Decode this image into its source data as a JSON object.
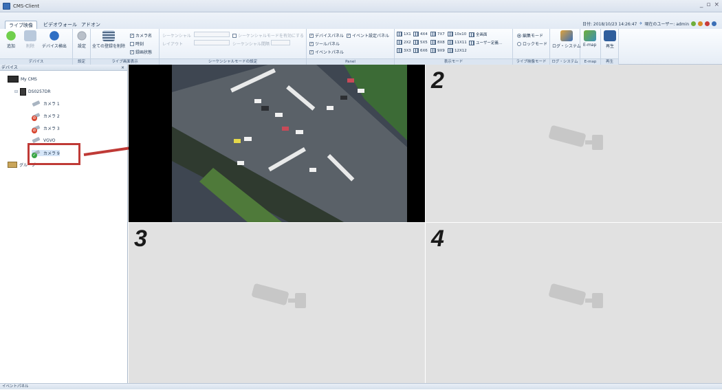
{
  "window": {
    "title": "CMS-Client",
    "controls": [
      "_",
      "▫",
      "×"
    ]
  },
  "tabs": [
    {
      "label": "ライブ映像",
      "active": true
    },
    {
      "label": "ビデオウォール",
      "active": false
    },
    {
      "label": "アドオン",
      "active": false
    }
  ],
  "status": {
    "date": "日付: 2018/10/23 14:26:47",
    "user": "現在のユーザー: admin"
  },
  "ribbon": {
    "device": {
      "group": "デバイス",
      "add": "追加",
      "delete": "削除",
      "detect": "デバイス検出"
    },
    "settings": {
      "group": "設定",
      "settings": "設定"
    },
    "live_display": {
      "group": "ライブ画面表示",
      "delete_all": "全ての登録を削除",
      "camera_name": "カメラ名",
      "time": "時刻",
      "record_state": "録画状態"
    },
    "sequence": {
      "group": "シーケンシャルモードの設定",
      "sequential": "シーケンシャル",
      "layout": "レイアウト",
      "enable": "シーケンシャルモードを有効にする",
      "interval": "シーケンシャル間隔"
    },
    "panel": {
      "group": "Panel",
      "device_panel": "デバイスパネル",
      "event_settings_panel": "イベント設定パネル",
      "tool_panel": "ツールパネル",
      "event_panel": "イベントパネル"
    },
    "display_mode": {
      "group": "表示モード",
      "layouts": [
        [
          "1X1",
          "4X4",
          "7X7",
          "10x10",
          "全画面"
        ],
        [
          "2X2",
          "5X5",
          "8X8",
          "11X11",
          "ユーザー定義..."
        ],
        [
          "3X3",
          "6X6",
          "9X9",
          "12X12"
        ]
      ]
    },
    "live_mode": {
      "group": "ライブ映像モード",
      "edit": "編集モード",
      "lock": "ロックモード"
    },
    "log": {
      "group": "ログ・システム",
      "label": "ログ・システム"
    },
    "emap": {
      "group": "E-map",
      "label": "E-map"
    },
    "playback": {
      "group": "再生",
      "label": "再生"
    }
  },
  "device_panel": {
    "title": "デバイス",
    "root": "My CMS",
    "recorder": "DS0257DR",
    "cameras": [
      {
        "label": "カメラ 1",
        "state": "normal"
      },
      {
        "label": "カメラ 2",
        "state": "error"
      },
      {
        "label": "カメラ 3",
        "state": "error"
      },
      {
        "label": "VGVO",
        "state": "normal"
      },
      {
        "label": "カメラ 9",
        "state": "ok"
      }
    ],
    "group_node": "グループ"
  },
  "views": [
    {
      "number": "",
      "content": "intersection-video"
    },
    {
      "number": "2",
      "content": "no-camera"
    },
    {
      "number": "3",
      "content": "no-camera"
    },
    {
      "number": "4",
      "content": "no-camera"
    }
  ],
  "statusbar": {
    "text": "イベントパネル"
  },
  "colors": {
    "accent": "#3a6fb6",
    "highlight": "#bf3a36",
    "cell_bg": "#e1e1e1"
  }
}
